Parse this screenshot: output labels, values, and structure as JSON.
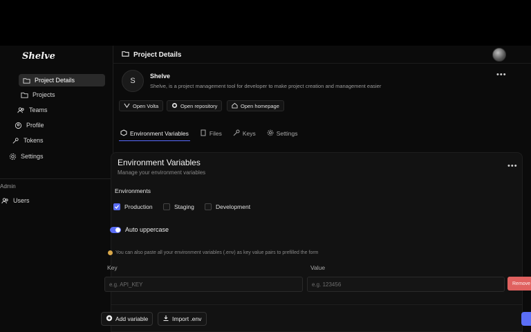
{
  "app": {
    "logo_text": "Shelve"
  },
  "sidebar": {
    "items": [
      {
        "label": "Project Details",
        "icon": "folder-open-icon",
        "active": true
      },
      {
        "label": "Projects",
        "icon": "folder-icon"
      },
      {
        "label": "Teams",
        "icon": "users-icon"
      },
      {
        "label": "Profile",
        "icon": "user-circle-icon"
      },
      {
        "label": "Tokens",
        "icon": "key-icon"
      },
      {
        "label": "Settings",
        "icon": "gear-icon"
      }
    ],
    "admin_label": "Admin",
    "admin_items": [
      {
        "label": "Users",
        "icon": "users-icon"
      }
    ]
  },
  "header": {
    "title": "Project Details"
  },
  "project": {
    "initial": "S",
    "name": "Shelve",
    "description": "Shelve, is a project management tool for developer to make project creation and management easier",
    "links": [
      {
        "label": "Open Volta",
        "icon": "volta-icon"
      },
      {
        "label": "Open repository",
        "icon": "github-icon"
      },
      {
        "label": "Open homepage",
        "icon": "home-icon"
      }
    ]
  },
  "tabs": [
    {
      "label": "Environment Variables",
      "icon": "box-icon",
      "active": true
    },
    {
      "label": "Files",
      "icon": "files-icon"
    },
    {
      "label": "Keys",
      "icon": "key-icon"
    },
    {
      "label": "Settings",
      "icon": "gear-icon"
    }
  ],
  "env_card": {
    "title": "Environment Variables",
    "subtitle": "Manage your environment variables",
    "environments_label": "Environments",
    "environments": [
      {
        "label": "Production",
        "checked": true
      },
      {
        "label": "Staging",
        "checked": false
      },
      {
        "label": "Development",
        "checked": false
      }
    ],
    "auto_uppercase": {
      "label": "Auto uppercase",
      "on": true
    },
    "hint": "You can also paste all your environment variables (.env) as key value pairs to prefilled the form",
    "key_header": "Key",
    "value_header": "Value",
    "key_placeholder": "e.g. API_KEY",
    "value_placeholder": "e.g. 123456",
    "remove_label": "Remove",
    "add_variable_label": "Add variable",
    "import_label": "Import .env"
  },
  "colors": {
    "accent": "#5b6ef5",
    "danger": "#e0615f",
    "background": "#0b0b0b"
  }
}
